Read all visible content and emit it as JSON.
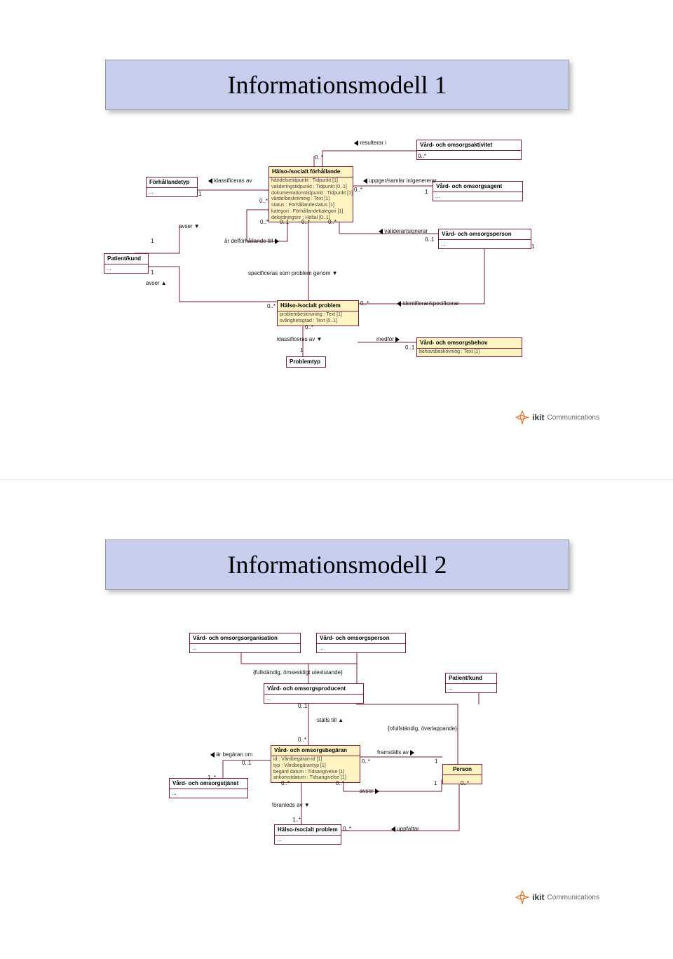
{
  "page1": {
    "title": "Informationsmodell 1",
    "boxes": {
      "forhallandetyp": {
        "name": "Förhållandetyp",
        "body": "..."
      },
      "patientkund": {
        "name": "Patient/kund",
        "body": "..."
      },
      "halso_forhallande": {
        "name": "Hälso-/socialt förhållande",
        "body": "händelsetidpunkt : Tidpunkt [1]\nvalideringstidpunkt : Tidpunkt [0..1]\ndokumentationstidpunkt : Tidpunkt [1]\nvärde/beskrivning : Text [1]\nstatus : Förhållandestatus [1]\nkategori : Förhållandekategori [1]\ndelordningsnr : Heltal [0..1]"
      },
      "vard_aktivitet": {
        "name": "Vård- och omsorgsaktivitet",
        "body": "..."
      },
      "vard_agent": {
        "name": "Vård- och omsorgsagent",
        "body": "..."
      },
      "vard_person": {
        "name": "Vård- och omsorgsperson",
        "body": "..."
      },
      "halso_problem": {
        "name": "Hälso-/socialt problem",
        "body": "problembeskrivning : Text [1]\nsvårighetsgrad : Text [0..1]"
      },
      "problemtyp": {
        "name": "Problemtyp"
      },
      "vard_behov": {
        "name": "Vård- och omsorgsbehov",
        "body": "behovsbeskrivning : Text [1]"
      }
    },
    "labels": {
      "resulterar_i": "resulterar i",
      "klassificeras_av": "klassificeras av",
      "uppger": "uppger/samlar in/genererar",
      "validerar": "validerar/signerar",
      "avser": "avser",
      "delforhallande": "är delförhållande till",
      "specificeras": "specificeras som problem genom",
      "klassificeras_av2": "klassificeras av",
      "medfor": "medför",
      "identifierar": "identifierar/specificerar"
    },
    "mult": {
      "zero_star": "0..*",
      "one": "1",
      "zero_one": "0..1",
      "zero_one_p": "0..1"
    },
    "logo": {
      "brand": "ikit",
      "text": "Communications"
    }
  },
  "page2": {
    "title": "Informationsmodell 2",
    "boxes": {
      "vard_org": {
        "name": "Vård- och omsorgsorganisation",
        "body": "..."
      },
      "vard_person": {
        "name": "Vård- och omsorgsperson",
        "body": "..."
      },
      "vard_producent": {
        "name": "Vård- och omsorgsproducent",
        "body": "..."
      },
      "patientkund": {
        "name": "Patient/kund",
        "body": "..."
      },
      "vard_begaran": {
        "name": "Vård- och omsorgsbegäran",
        "body": "id : Vårdbegäran-id [1]\ntyp : Vårdbegärantyp [1]\nbegärd datum : Tidsangivelse [1]\nankomstdatum : Tidsangivelse [1]"
      },
      "person": {
        "name": "Person"
      },
      "vard_tjanst": {
        "name": "Vård- och omsorgstjänst",
        "body": "..."
      },
      "halso_problem": {
        "name": "Hälso-/socialt problem",
        "body": "..."
      }
    },
    "labels": {
      "constraint1": "{fullständig, ömsesidigt uteslutande}",
      "constraint2": "{ofullständig, överlappande}",
      "stalls_till": "ställs till",
      "ar_begaran_om": "är begäran om",
      "framstalls_av": "framställs av",
      "avser": "avser",
      "foranleds_av": "föranleds av",
      "uppfattar": "uppfattar"
    },
    "mult": {
      "zero_star": "0..*",
      "one": "1",
      "zero_one": "0..1",
      "one_star": "1..*"
    },
    "logo": {
      "brand": "ikit",
      "text": "Communications"
    }
  }
}
